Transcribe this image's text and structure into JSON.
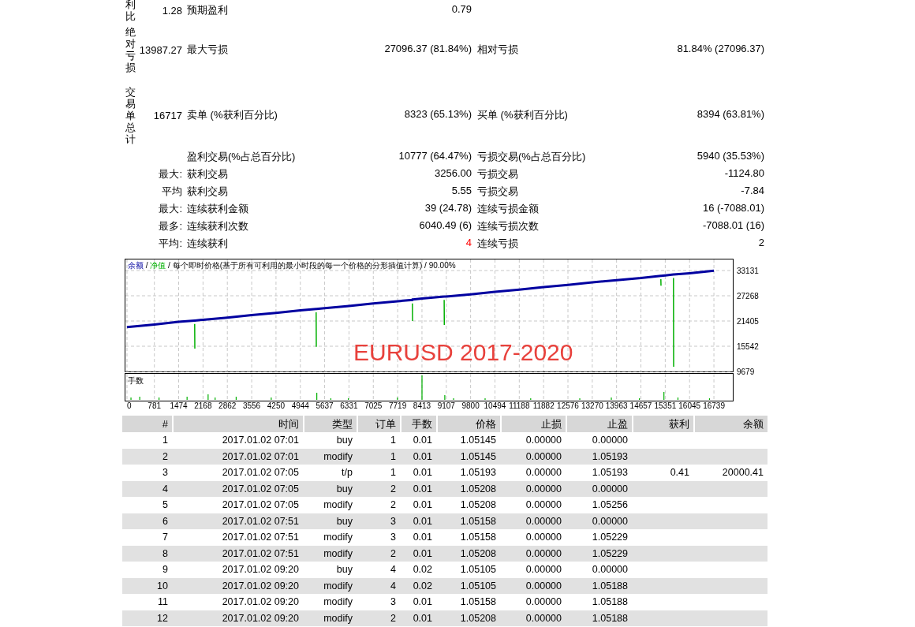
{
  "stats": [
    {
      "kind": "group",
      "heading": "利比",
      "value": "1.28",
      "name1": "预期盈利",
      "value1": "0.79",
      "alert": false
    },
    {
      "kind": "group",
      "heading": "绝对亏损",
      "value": "13987.27",
      "name1": "最大亏损",
      "value1": "27096.37 (81.84%)",
      "name2": "相对亏损",
      "value2": "81.84% (27096.37)",
      "alert": false
    },
    {
      "kind": "group",
      "heading": "交易单总计",
      "value": "16717",
      "name1": "卖单 (%获利百分比)",
      "value1": "8323 (65.13%)",
      "name2": "买单 (%获利百分比)",
      "value2": "8394 (63.81%)",
      "alert": false
    },
    {
      "kind": "plain",
      "name1": "盈利交易(%占总百分比)",
      "value1": "10777 (64.47%)",
      "name2": "亏损交易(%占总百分比)",
      "value2": "5940 (35.53%)",
      "alert": false
    },
    {
      "kind": "plain",
      "prefix": "最大:",
      "name1": "获利交易",
      "value1": "3256.00",
      "name2": "亏损交易",
      "value2": "-1124.80",
      "alert": false
    },
    {
      "kind": "plain",
      "prefix": "平均",
      "name1": "获利交易",
      "value1": "5.55",
      "name2": "亏损交易",
      "value2": "-7.84",
      "alert": false
    },
    {
      "kind": "plain",
      "prefix": "最大:",
      "name1": "连续获利金额",
      "value1": "39 (24.78)",
      "name2": "连续亏损金额",
      "value2": "16 (-7088.01)",
      "alert": false
    },
    {
      "kind": "plain",
      "prefix": "最多:",
      "name1": "连续获利次数",
      "value1": "6040.49 (6)",
      "name2": "连续亏损次数",
      "value2": "-7088.01 (16)",
      "alert": false
    },
    {
      "kind": "plain",
      "prefix": "平均:",
      "name1": "连续获利",
      "value1": "4",
      "name2": "连续亏损",
      "value2": "2",
      "alert": true
    }
  ],
  "chart": {
    "legend_separator": " / ",
    "legend_suffix": " / 每个即时价格(基于所有可利用的最小时段的每一个价格的分形插值计算) / 90.00%",
    "lots_label": "手数",
    "chart_data": {
      "type": "line",
      "grid": true,
      "xlim": [
        0,
        17300
      ],
      "ylim": [
        9679,
        35880
      ],
      "xticks": [
        0,
        781,
        1474,
        2168,
        2862,
        3556,
        4250,
        4944,
        5637,
        6331,
        7025,
        7719,
        8413,
        9107,
        9800,
        10494,
        11188,
        11882,
        12576,
        13270,
        13963,
        14657,
        15351,
        16045,
        16739
      ],
      "yticks": [
        9679,
        15542,
        21405,
        27268,
        33131
      ],
      "x": [
        0,
        781,
        1474,
        1930,
        1935,
        1940,
        2168,
        2862,
        3556,
        4250,
        4944,
        5395,
        5400,
        5405,
        5637,
        6331,
        7025,
        7719,
        8140,
        8144,
        8148,
        8413,
        9045,
        9050,
        9055,
        9107,
        9800,
        10494,
        11188,
        11882,
        12576,
        13270,
        13963,
        14657,
        15225,
        15230,
        15235,
        15351,
        15585,
        15590,
        15595,
        16045,
        16739
      ],
      "series": [
        {
          "name": "余额",
          "color": "#0000a0",
          "values": [
            20000,
            20600,
            21200,
            21500,
            21500,
            21500,
            21700,
            22200,
            22800,
            23300,
            23900,
            24200,
            24200,
            24200,
            24400,
            24900,
            25500,
            26000,
            26300,
            26400,
            26400,
            26600,
            27100,
            27100,
            27100,
            27100,
            27600,
            28200,
            28700,
            29300,
            29800,
            30400,
            30900,
            31400,
            31900,
            31900,
            31900,
            32000,
            32200,
            32200,
            32200,
            32500,
            33100
          ]
        },
        {
          "name": "净值",
          "color": "#00b000",
          "values": [
            null,
            null,
            null,
            20700,
            15000,
            null,
            null,
            null,
            null,
            null,
            null,
            23400,
            15400,
            null,
            null,
            null,
            null,
            null,
            25500,
            21400,
            null,
            null,
            26300,
            20500,
            null,
            null,
            null,
            null,
            null,
            null,
            null,
            null,
            null,
            null,
            31100,
            29600,
            null,
            null,
            31400,
            10800,
            null,
            null,
            null
          ]
        }
      ],
      "annotations": [
        "EURUSD 2017-2020"
      ]
    }
  },
  "table": {
    "columns": [
      "#",
      "时间",
      "类型",
      "订单",
      "手数",
      "价格",
      "止损",
      "止盈",
      "获利",
      "余额"
    ],
    "rows": [
      [
        "1",
        "2017.01.02 07:01",
        "buy",
        "1",
        "0.01",
        "1.05145",
        "0.00000",
        "0.00000",
        "",
        ""
      ],
      [
        "2",
        "2017.01.02 07:01",
        "modify",
        "1",
        "0.01",
        "1.05145",
        "0.00000",
        "1.05193",
        "",
        ""
      ],
      [
        "3",
        "2017.01.02 07:05",
        "t/p",
        "1",
        "0.01",
        "1.05193",
        "0.00000",
        "1.05193",
        "0.41",
        "20000.41"
      ],
      [
        "4",
        "2017.01.02 07:05",
        "buy",
        "2",
        "0.01",
        "1.05208",
        "0.00000",
        "0.00000",
        "",
        ""
      ],
      [
        "5",
        "2017.01.02 07:05",
        "modify",
        "2",
        "0.01",
        "1.05208",
        "0.00000",
        "1.05256",
        "",
        ""
      ],
      [
        "6",
        "2017.01.02 07:51",
        "buy",
        "3",
        "0.01",
        "1.05158",
        "0.00000",
        "0.00000",
        "",
        ""
      ],
      [
        "7",
        "2017.01.02 07:51",
        "modify",
        "3",
        "0.01",
        "1.05158",
        "0.00000",
        "1.05229",
        "",
        ""
      ],
      [
        "8",
        "2017.01.02 07:51",
        "modify",
        "2",
        "0.01",
        "1.05208",
        "0.00000",
        "1.05229",
        "",
        ""
      ],
      [
        "9",
        "2017.01.02 09:20",
        "buy",
        "4",
        "0.02",
        "1.05105",
        "0.00000",
        "0.00000",
        "",
        ""
      ],
      [
        "10",
        "2017.01.02 09:20",
        "modify",
        "4",
        "0.02",
        "1.05105",
        "0.00000",
        "1.05188",
        "",
        ""
      ],
      [
        "11",
        "2017.01.02 09:20",
        "modify",
        "3",
        "0.01",
        "1.05158",
        "0.00000",
        "1.05188",
        "",
        ""
      ],
      [
        "12",
        "2017.01.02 09:20",
        "modify",
        "2",
        "0.01",
        "1.05208",
        "0.00000",
        "1.05188",
        "",
        ""
      ]
    ]
  }
}
